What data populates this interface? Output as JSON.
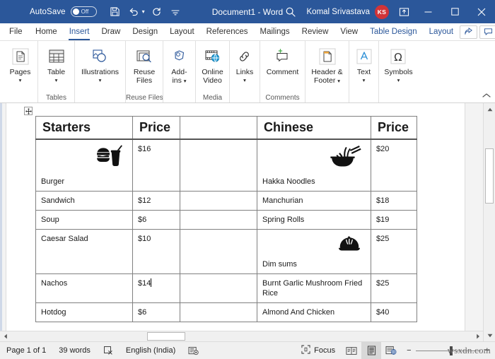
{
  "titlebar": {
    "autosave_label": "AutoSave",
    "autosave_state": "Off",
    "document_title": "Document1  -  Word",
    "account_name": "Komal Srivastava",
    "avatar_initials": "KS",
    "icons": {
      "save": "save-icon",
      "undo": "undo-icon",
      "redo": "redo-icon",
      "qat_more": "customize-quick-access-toolbar-icon",
      "search": "search-icon",
      "ribbon_display": "ribbon-display-options-icon",
      "minimize": "minimize-icon",
      "maximize": "maximize-icon",
      "close": "close-icon"
    }
  },
  "tabs": [
    {
      "label": "File",
      "active": false,
      "contextual": false
    },
    {
      "label": "Home",
      "active": false,
      "contextual": false
    },
    {
      "label": "Insert",
      "active": true,
      "contextual": false
    },
    {
      "label": "Draw",
      "active": false,
      "contextual": false
    },
    {
      "label": "Design",
      "active": false,
      "contextual": false
    },
    {
      "label": "Layout",
      "active": false,
      "contextual": false
    },
    {
      "label": "References",
      "active": false,
      "contextual": false
    },
    {
      "label": "Mailings",
      "active": false,
      "contextual": false
    },
    {
      "label": "Review",
      "active": false,
      "contextual": false
    },
    {
      "label": "View",
      "active": false,
      "contextual": false
    },
    {
      "label": "Table Design",
      "active": false,
      "contextual": true
    },
    {
      "label": "Layout",
      "active": false,
      "contextual": true
    }
  ],
  "tabs_right": {
    "share_icon": "share-icon",
    "comments_icon": "comments-icon"
  },
  "ribbon": {
    "collapse_label": "^",
    "groups": [
      {
        "title": "",
        "buttons": [
          {
            "label": "Pages",
            "caret": true,
            "icon": "pages-icon"
          }
        ]
      },
      {
        "title": "Tables",
        "buttons": [
          {
            "label": "Table",
            "caret": true,
            "icon": "table-icon"
          }
        ]
      },
      {
        "title": "",
        "buttons": [
          {
            "label": "Illustrations",
            "caret": true,
            "icon": "illustrations-icon"
          }
        ]
      },
      {
        "title": "Reuse Files",
        "buttons": [
          {
            "label": "Reuse Files",
            "caret": false,
            "icon": "reuse-files-icon"
          }
        ]
      },
      {
        "title": "",
        "buttons": [
          {
            "label": "Add-ins",
            "caret": true,
            "inline_caret": true,
            "icon": "add-ins-icon"
          }
        ]
      },
      {
        "title": "Media",
        "buttons": [
          {
            "label": "Online Video",
            "caret": false,
            "icon": "online-video-icon"
          }
        ]
      },
      {
        "title": "",
        "buttons": [
          {
            "label": "Links",
            "caret": true,
            "icon": "links-icon"
          }
        ]
      },
      {
        "title": "Comments",
        "buttons": [
          {
            "label": "Comment",
            "caret": false,
            "icon": "comment-icon"
          }
        ]
      },
      {
        "title": "",
        "buttons": [
          {
            "label": "Header & Footer",
            "caret": true,
            "inline_caret": true,
            "icon": "header-footer-icon"
          }
        ]
      },
      {
        "title": "",
        "buttons": [
          {
            "label": "Text",
            "caret": true,
            "icon": "text-icon"
          }
        ]
      },
      {
        "title": "",
        "buttons": [
          {
            "label": "Symbols",
            "caret": true,
            "icon": "symbols-icon"
          }
        ]
      }
    ]
  },
  "document": {
    "table_move_handle_icon": "table-move-handle-icon",
    "table": {
      "headers": [
        "Starters",
        "Price",
        "",
        "Chinese",
        "Price"
      ],
      "rows": [
        {
          "item": "Burger",
          "item_icon": "burger-and-drink-icon",
          "price": "$16",
          "gap": "",
          "item2": "Hakka Noodles",
          "item2_icon": "noodle-bowl-icon",
          "price2": "$20",
          "tall": true
        },
        {
          "item": "Sandwich",
          "item_icon": "",
          "price": "$12",
          "gap": "",
          "item2": "Manchurian",
          "item2_icon": "",
          "price2": "$18",
          "tall": false
        },
        {
          "item": "Soup",
          "item_icon": "",
          "price": "$6",
          "gap": "",
          "item2": "Spring Rolls",
          "item2_icon": "",
          "price2": "$19",
          "tall": false
        },
        {
          "item": "Caesar Salad",
          "item_icon": "",
          "price": "$10",
          "gap": "",
          "item2": "Dim sums",
          "item2_icon": "dumpling-icon",
          "price2": "$25",
          "tall": true
        },
        {
          "item": "Nachos",
          "item_icon": "",
          "price": "$14",
          "price_has_cursor": true,
          "gap": "",
          "item2": "Burnt Garlic Mushroom Fried Rice",
          "item2_icon": "",
          "price2": "$25",
          "tall": false
        },
        {
          "item": "Hotdog",
          "item_icon": "",
          "price": "$6",
          "gap": "",
          "item2": "Almond And Chicken",
          "item2_icon": "",
          "price2": "$40",
          "tall": false
        }
      ]
    }
  },
  "statusbar": {
    "page_info": "Page 1 of 1",
    "word_count": "39 words",
    "proofing_icon": "proofing-errors-icon",
    "language": "English (India)",
    "accessibility_icon": "accessibility-checker-icon",
    "focus_label": "Focus",
    "focus_icon": "focus-mode-icon",
    "view_read_icon": "read-mode-icon",
    "view_print_icon": "print-layout-icon",
    "view_web_icon": "web-layout-icon",
    "zoom_out": "−",
    "zoom_in": "+",
    "watermark": "wsxdn.com"
  }
}
